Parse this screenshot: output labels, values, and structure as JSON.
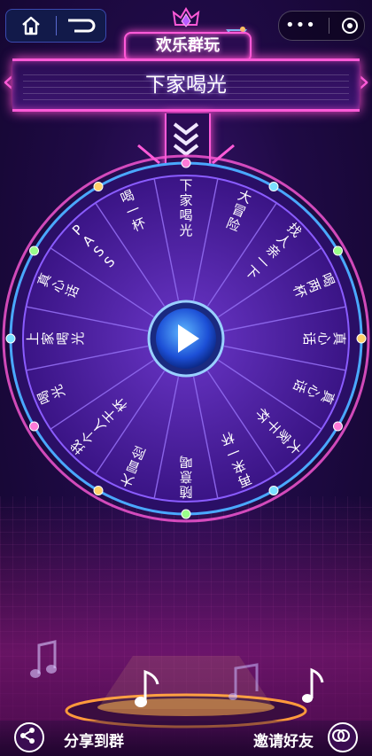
{
  "logo": {
    "text": "欢乐群玩"
  },
  "banner": {
    "result": "下家喝光"
  },
  "wheel": {
    "segments": [
      "下家喝光",
      "大冒险",
      "找人亲一下",
      "喝两杯",
      "真心话",
      "真心话",
      "大家干杯",
      "再来一杯",
      "随意喝",
      "大冒险",
      "找个人干杯",
      "喝光",
      "上家喝光",
      "真心话",
      "PASS",
      "喝一杯"
    ]
  },
  "bottom": {
    "share_label": "分享到群",
    "invite_label": "邀请好友"
  },
  "colors": {
    "neon_pink": "#ff5ad8",
    "neon_blue": "#4aa8ff",
    "wheel_fill": "#4a1d94"
  }
}
